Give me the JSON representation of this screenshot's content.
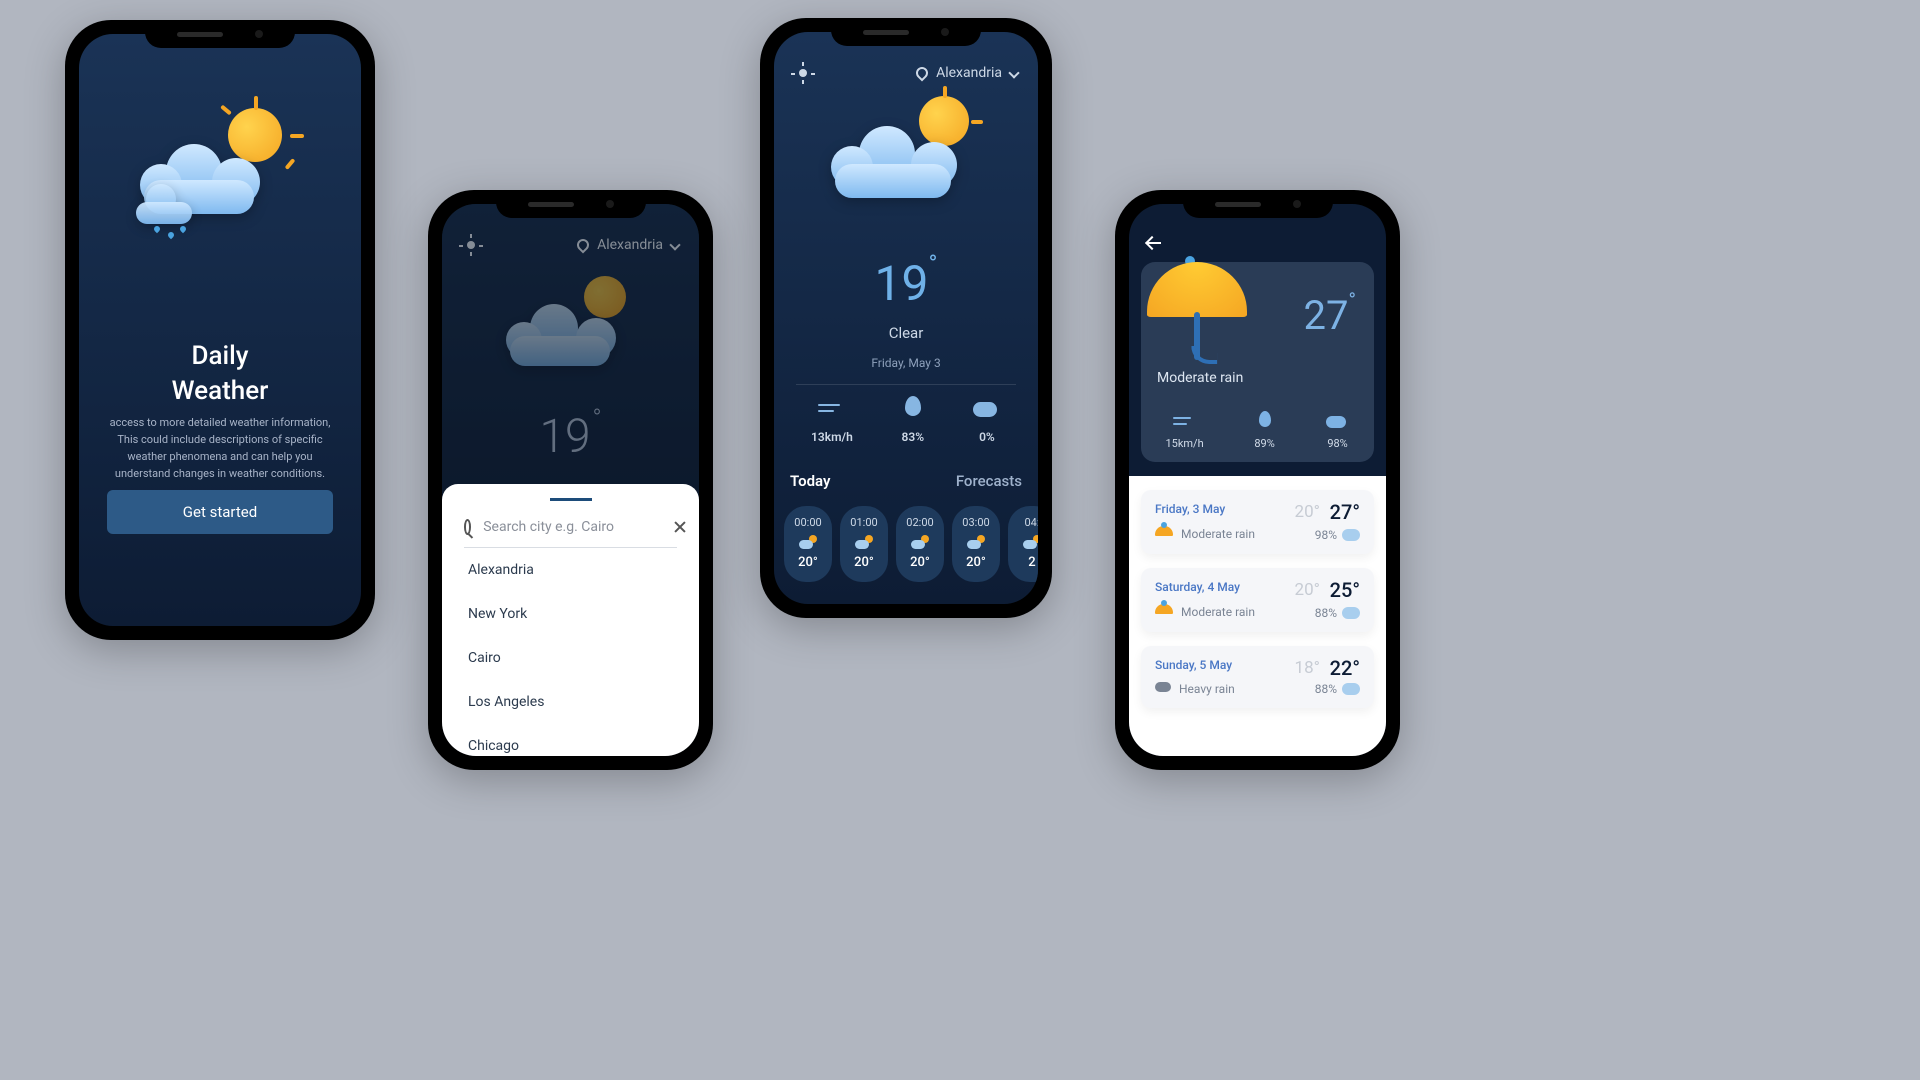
{
  "screen1": {
    "title_line1": "Daily",
    "title_line2": "Weather",
    "description": "access to more detailed weather information, This could include descriptions of specific weather phenomena and can help you understand changes in weather conditions.",
    "cta": "Get started"
  },
  "screen2": {
    "location": "Alexandria",
    "temperature": "19",
    "search_placeholder": "Search city e.g. Cairo",
    "cities": [
      "Alexandria",
      "New York",
      "Cairo",
      "Los Angeles",
      "Chicago"
    ]
  },
  "screen3": {
    "location": "Alexandria",
    "temperature": "19",
    "condition": "Clear",
    "date": "Friday, May 3",
    "wind": "13km/h",
    "humidity": "83%",
    "cloud": "0%",
    "tab_today": "Today",
    "tab_forecasts": "Forecasts",
    "hours": [
      {
        "time": "00:00",
        "temp": "20°"
      },
      {
        "time": "01:00",
        "temp": "20°"
      },
      {
        "time": "02:00",
        "temp": "20°"
      },
      {
        "time": "03:00",
        "temp": "20°"
      },
      {
        "time": "04:",
        "temp": "2"
      }
    ]
  },
  "screen4": {
    "temperature": "27",
    "condition": "Moderate rain",
    "wind": "15km/h",
    "humidity": "89%",
    "cloud": "98%",
    "days": [
      {
        "date": "Friday, 3 May",
        "lo": "20°",
        "hi": "27°",
        "cond": "Moderate rain",
        "pct": "98%",
        "icon": "umbrella"
      },
      {
        "date": "Saturday, 4 May",
        "lo": "20°",
        "hi": "25°",
        "cond": "Moderate rain",
        "pct": "88%",
        "icon": "umbrella"
      },
      {
        "date": "Sunday, 5 May",
        "lo": "18°",
        "hi": "22°",
        "cond": "Heavy rain",
        "pct": "88%",
        "icon": "storm"
      }
    ]
  }
}
